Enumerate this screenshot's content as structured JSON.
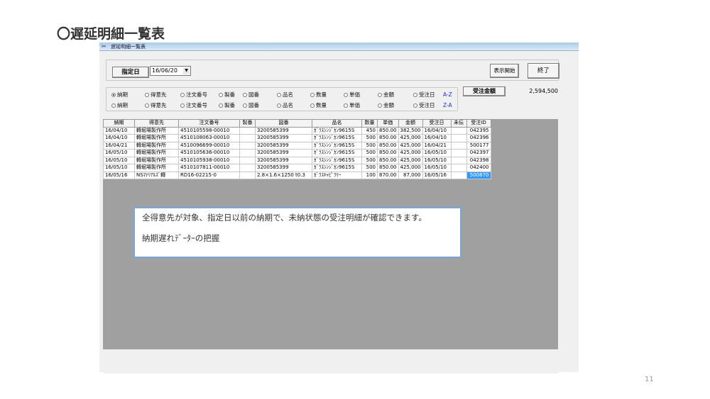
{
  "slide": {
    "title": "〇遅延明細一覧表",
    "page_number": "11"
  },
  "window": {
    "title": "遅延明細一覧表"
  },
  "filter": {
    "date_label": "指定日",
    "date_value": "16/06/20"
  },
  "buttons": {
    "show": "表示開始",
    "end": "終了"
  },
  "sort": {
    "row1": [
      {
        "label": "納期",
        "selected": true
      },
      {
        "label": "得意先",
        "selected": false
      },
      {
        "label": "注文番号",
        "selected": false
      },
      {
        "label": "製番",
        "selected": false
      },
      {
        "label": "図番",
        "selected": false
      },
      {
        "label": "品名",
        "selected": false
      },
      {
        "label": "数量",
        "selected": false
      },
      {
        "label": "単価",
        "selected": false
      },
      {
        "label": "金額",
        "selected": false
      },
      {
        "label": "受注日",
        "selected": false
      }
    ],
    "row2": [
      {
        "label": "納期",
        "selected": false
      },
      {
        "label": "得意先",
        "selected": false
      },
      {
        "label": "注文番号",
        "selected": false
      },
      {
        "label": "製番",
        "selected": false
      },
      {
        "label": "図番",
        "selected": false
      },
      {
        "label": "品名",
        "selected": false
      },
      {
        "label": "数量",
        "selected": false
      },
      {
        "label": "単価",
        "selected": false
      },
      {
        "label": "金額",
        "selected": false
      },
      {
        "label": "受注日",
        "selected": false
      }
    ],
    "asc": "A-Z",
    "desc": "Z-A"
  },
  "total": {
    "label": "受注金額",
    "value": "2,594,500"
  },
  "table": {
    "columns": [
      "納期",
      "得意先",
      "注文番号",
      "製番",
      "図番",
      "品名",
      "数量",
      "単価",
      "金額",
      "受注日",
      "未伝",
      "受注ID"
    ],
    "rows": [
      [
        "16/04/10",
        "轉堀場製作所",
        "4510105598-00010",
        "",
        "3200585399",
        "ｶﾞﾗｽｼﾝｼﾞｶﾝ9615S",
        "450",
        "850.00",
        "382,500",
        "16/04/10",
        "",
        "042395"
      ],
      [
        "16/04/10",
        "轉堀場製作所",
        "4510108063-00010",
        "",
        "3200585399",
        "ｶﾞﾗｽｼﾝｼﾞｶﾝ9615S",
        "500",
        "850.00",
        "425,000",
        "16/04/10",
        "",
        "042396"
      ],
      [
        "16/04/21",
        "轉堀場製作所",
        "4510096699-00010",
        "",
        "3200585399",
        "ｶﾞﾗｽｼﾝｼﾞｶﾝ9615S",
        "500",
        "850.00",
        "425,000",
        "16/04/21",
        "",
        "500177"
      ],
      [
        "16/05/10",
        "轉堀場製作所",
        "4510105636-00010",
        "",
        "3200585399",
        "ｶﾞﾗｽｼﾝｼﾞｶﾝ9615S",
        "500",
        "850.00",
        "425,000",
        "16/05/10",
        "",
        "042397"
      ],
      [
        "16/05/10",
        "轉堀場製作所",
        "4510105938-00010",
        "",
        "3200585399",
        "ｶﾞﾗｽｼﾝｼﾞｶﾝ9615S",
        "500",
        "850.00",
        "425,000",
        "16/05/10",
        "",
        "042398"
      ],
      [
        "16/05/10",
        "轉堀場製作所",
        "4510107811-00010",
        "",
        "3200585399",
        "ｶﾞﾗｽｼﾝｼﾞｶﾝ9615S",
        "500",
        "850.00",
        "425,000",
        "16/05/10",
        "",
        "042400"
      ],
      [
        "16/05/16",
        "NSﾏﾃﾘｱﾙｽﾞ轉",
        "RD16-02215-0",
        "",
        "2.8×1.6×1250 t0.3",
        "ｶﾞﾗｽｷｬﾋﾟﾗﾘｰ",
        "100",
        "870.00",
        "87,000",
        "16/05/16",
        "",
        "500870"
      ]
    ]
  },
  "note": {
    "line1": "全得意先が対象、指定日以前の納期で、未納状態の受注明細が確認できます。",
    "line2": "納期遅れﾃﾞｰﾀｰの把握"
  },
  "colors": {
    "selection": "#3399ff",
    "sort_key": "#1c2fd6",
    "note_border": "#7aa6d6"
  }
}
